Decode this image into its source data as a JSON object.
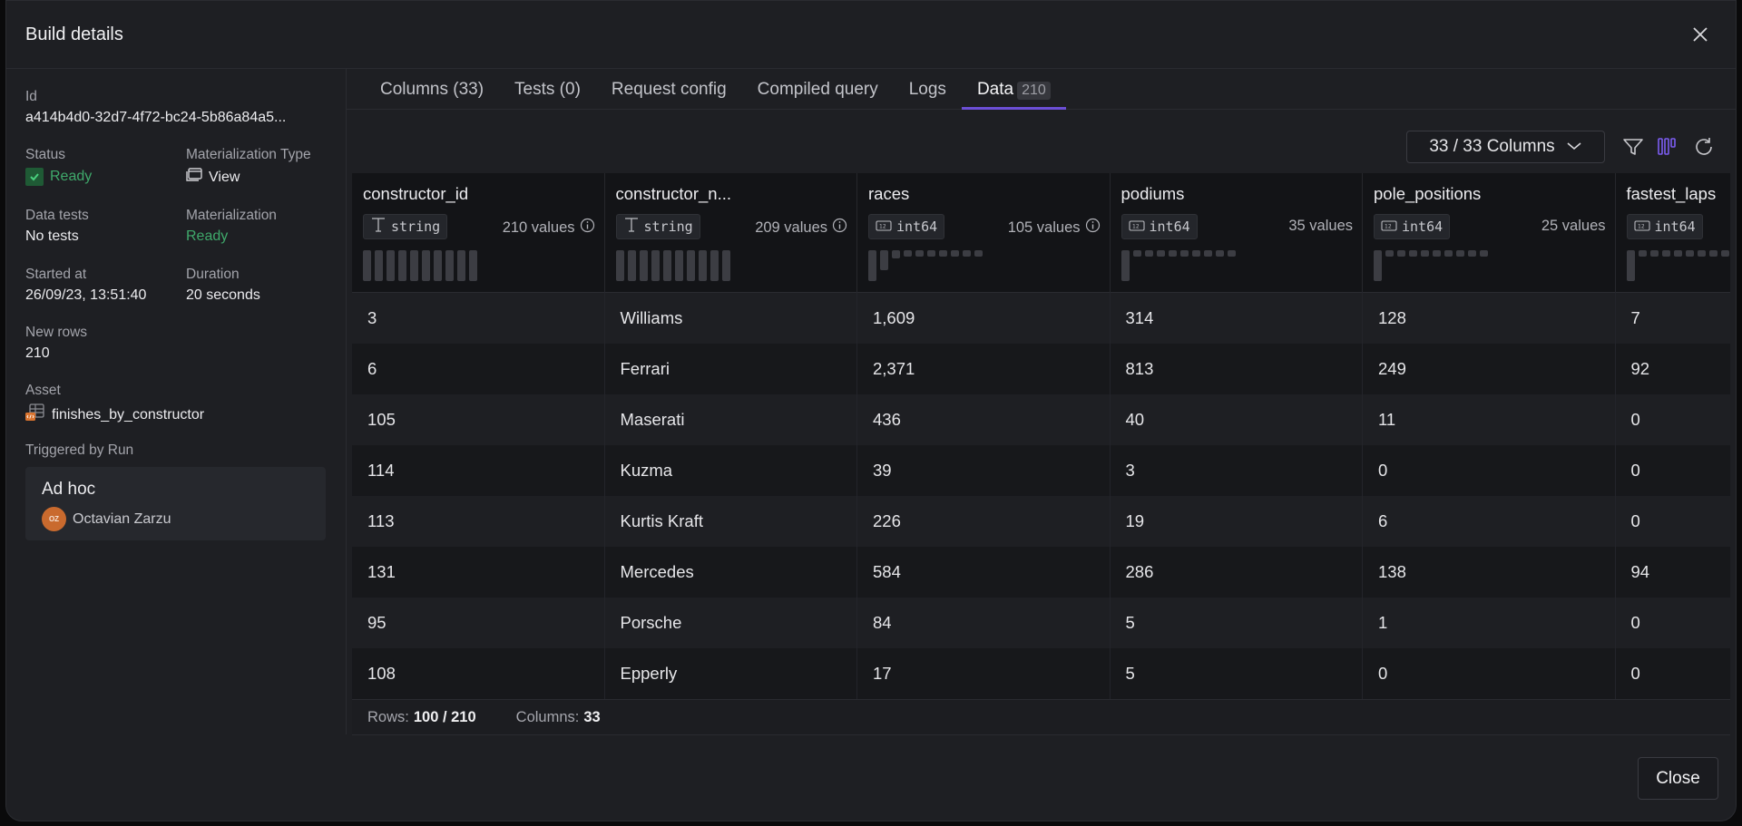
{
  "modal": {
    "title": "Build details",
    "close_button": "Close"
  },
  "sidebar": {
    "id_label": "Id",
    "id_value": "a414b4d0-32d7-4f72-bc24-5b86a84a5...",
    "status_label": "Status",
    "status_value": "Ready",
    "mat_type_label": "Materialization Type",
    "mat_type_value": "View",
    "data_tests_label": "Data tests",
    "data_tests_value": "No tests",
    "materialization_label": "Materialization",
    "materialization_value": "Ready",
    "started_label": "Started at",
    "started_value": "26/09/23, 13:51:40",
    "duration_label": "Duration",
    "duration_value": "20 seconds",
    "new_rows_label": "New rows",
    "new_rows_value": "210",
    "asset_label": "Asset",
    "asset_value": "finishes_by_constructor",
    "triggered_label": "Triggered by Run",
    "run_title": "Ad hoc",
    "run_user_initials": "OZ",
    "run_user_name": "Octavian Zarzu"
  },
  "tabs": [
    {
      "label": "Columns (33)"
    },
    {
      "label": "Tests (0)"
    },
    {
      "label": "Request config"
    },
    {
      "label": "Compiled query"
    },
    {
      "label": "Logs"
    },
    {
      "label": "Data",
      "badge": "210",
      "active": true
    }
  ],
  "toolbar": {
    "column_select": "33 / 33 Columns",
    "icons": [
      "filter-icon",
      "column-stats-icon",
      "refresh-icon"
    ]
  },
  "colors": {
    "accent": "#6c4fd6",
    "success": "#3fa96b",
    "avatar": "#c96a2e"
  },
  "table": {
    "columns": [
      {
        "name": "constructor_id",
        "type": "string",
        "values": "210 values",
        "info": true
      },
      {
        "name": "constructor_n...",
        "type": "string",
        "values": "209 values",
        "info": true
      },
      {
        "name": "races",
        "type": "int64",
        "values": "105 values",
        "info": true
      },
      {
        "name": "podiums",
        "type": "int64",
        "values": "35 values",
        "info": false
      },
      {
        "name": "pole_positions",
        "type": "int64",
        "values": "25 values",
        "info": false
      },
      {
        "name": "fastest_laps",
        "type": "int64",
        "values": "",
        "info": false
      }
    ],
    "rows": [
      [
        "3",
        "Williams",
        "1,609",
        "314",
        "128",
        "7"
      ],
      [
        "6",
        "Ferrari",
        "2,371",
        "813",
        "249",
        "92"
      ],
      [
        "105",
        "Maserati",
        "436",
        "40",
        "11",
        "0"
      ],
      [
        "114",
        "Kuzma",
        "39",
        "3",
        "0",
        "0"
      ],
      [
        "113",
        "Kurtis Kraft",
        "226",
        "19",
        "6",
        "0"
      ],
      [
        "131",
        "Mercedes",
        "584",
        "286",
        "138",
        "94"
      ],
      [
        "95",
        "Porsche",
        "84",
        "5",
        "1",
        "0"
      ],
      [
        "108",
        "Epperly",
        "17",
        "5",
        "0",
        "0"
      ]
    ]
  },
  "footer": {
    "rows_label": "Rows:",
    "rows_value": "100 / 210",
    "columns_label": "Columns:",
    "columns_value": "33"
  }
}
